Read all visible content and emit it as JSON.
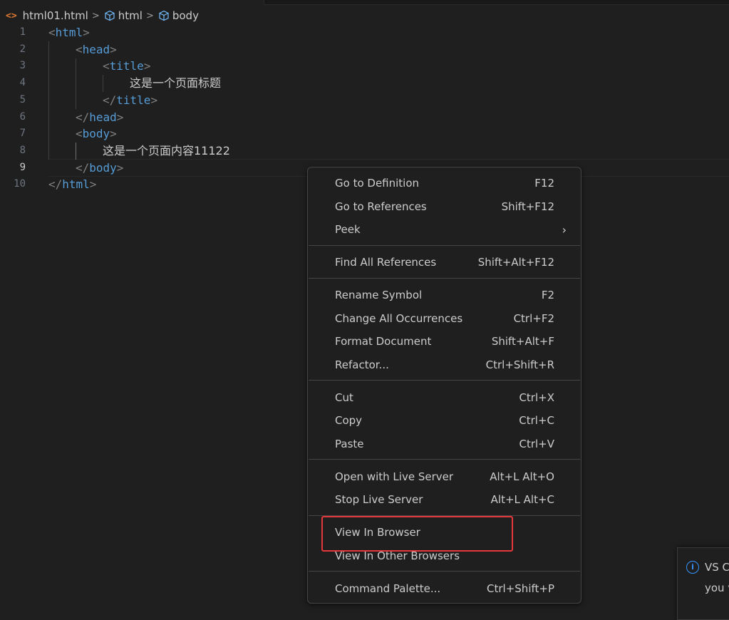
{
  "breadcrumb": {
    "file_icon": "<>",
    "file": "html01.html",
    "item1": "html",
    "item2": "body",
    "separator": ">"
  },
  "editor": {
    "lines": [
      {
        "n": "1",
        "open": "<",
        "tag": "html",
        "close": ">"
      },
      {
        "n": "2",
        "open": "<",
        "tag": "head",
        "close": ">"
      },
      {
        "n": "3",
        "open": "<",
        "tag": "title",
        "close": ">"
      },
      {
        "n": "4",
        "text": "这是一个页面标题"
      },
      {
        "n": "5",
        "open": "</",
        "tag": "title",
        "close": ">"
      },
      {
        "n": "6",
        "open": "</",
        "tag": "head",
        "close": ">"
      },
      {
        "n": "7",
        "open": "<",
        "tag": "body",
        "close": ">"
      },
      {
        "n": "8",
        "text": "这是一个页面内容11122"
      },
      {
        "n": "9",
        "open": "</",
        "tag": "body",
        "close": ">"
      },
      {
        "n": "10",
        "open": "</",
        "tag": "html",
        "close": ">"
      }
    ],
    "active_line": "9"
  },
  "context_menu": {
    "go_to_definition": {
      "label": "Go to Definition",
      "key": "F12"
    },
    "go_to_references": {
      "label": "Go to References",
      "key": "Shift+F12"
    },
    "peek": {
      "label": "Peek",
      "key": ""
    },
    "find_all_references": {
      "label": "Find All References",
      "key": "Shift+Alt+F12"
    },
    "rename_symbol": {
      "label": "Rename Symbol",
      "key": "F2"
    },
    "change_all_occurrences": {
      "label": "Change All Occurrences",
      "key": "Ctrl+F2"
    },
    "format_document": {
      "label": "Format Document",
      "key": "Shift+Alt+F"
    },
    "refactor": {
      "label": "Refactor...",
      "key": "Ctrl+Shift+R"
    },
    "cut": {
      "label": "Cut",
      "key": "Ctrl+X"
    },
    "copy": {
      "label": "Copy",
      "key": "Ctrl+C"
    },
    "paste": {
      "label": "Paste",
      "key": "Ctrl+V"
    },
    "open_live_server": {
      "label": "Open with Live Server",
      "key": "Alt+L Alt+O"
    },
    "stop_live_server": {
      "label": "Stop Live Server",
      "key": "Alt+L Alt+C"
    },
    "view_in_browser": {
      "label": "View In Browser",
      "key": ""
    },
    "view_in_other_browsers": {
      "label": "View In Other Browsers",
      "key": ""
    },
    "command_palette": {
      "label": "Command Palette...",
      "key": "Ctrl+Shift+P"
    }
  },
  "notification": {
    "line1": "VS C",
    "line2": "you v"
  },
  "colors": {
    "background": "#1f1f1f",
    "tag": "#569cd6",
    "bracket": "#808080",
    "highlight_box": "#e5383b",
    "info": "#3794ff"
  }
}
